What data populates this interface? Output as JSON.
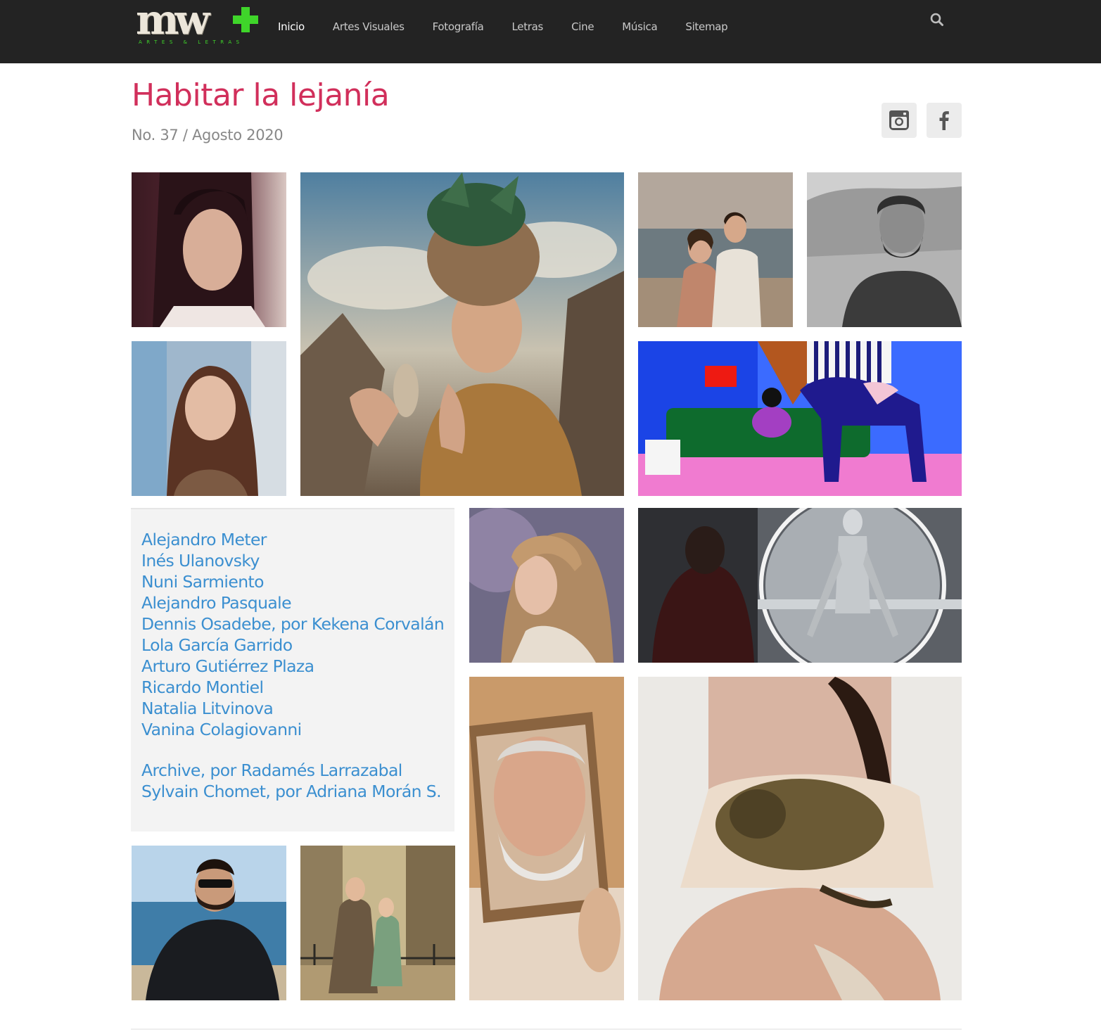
{
  "header": {
    "logo_text": "mw",
    "logo_subtitle": "ARTES & LETRAS",
    "nav": [
      {
        "label": "Inicio",
        "active": true
      },
      {
        "label": "Artes Visuales",
        "active": false
      },
      {
        "label": "Fotografía",
        "active": false
      },
      {
        "label": "Letras",
        "active": false
      },
      {
        "label": "Cine",
        "active": false
      },
      {
        "label": "Música",
        "active": false
      },
      {
        "label": "Sitemap",
        "active": false
      }
    ],
    "search_icon": "search-icon"
  },
  "page": {
    "title": "Habitar la lejanía",
    "subtitle": "No. 37 / Agosto 2020"
  },
  "social": {
    "instagram_icon": "instagram-icon",
    "facebook_icon": "facebook-icon"
  },
  "contributors": [
    "Alejandro Meter",
    "Inés Ulanovsky",
    "Nuni Sarmiento",
    "Alejandro Pasquale",
    "Dennis Osadebe, por Kekena Corvalán",
    "Lola García Garrido",
    "Arturo Gutiérrez Plaza",
    "Ricardo Montiel",
    "Natalia Litvinova",
    "Vanina Colagiovanni"
  ],
  "features": [
    "Archive, por Radamés Larrazabal",
    "Sylvain Chomet, por Adriana Morán S."
  ],
  "colors": {
    "header_bg": "#232323",
    "title": "#d12f5b",
    "link": "#3b8fd0",
    "logo_plus": "#3fd52a"
  }
}
